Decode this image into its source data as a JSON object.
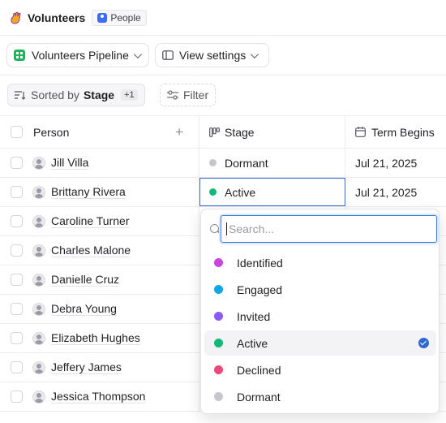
{
  "header": {
    "title": "Volunteers",
    "badge": "People"
  },
  "toolbar": {
    "pipeline_label": "Volunteers Pipeline",
    "view_settings_label": "View settings"
  },
  "sortbar": {
    "sorted_by": "Sorted by",
    "sort_field": "Stage",
    "sort_extra": "+1",
    "filter_label": "Filter"
  },
  "columns": {
    "person": "Person",
    "stage": "Stage",
    "term_begins": "Term Begins"
  },
  "rows": [
    {
      "name": "Jill Villa",
      "stage": "Dormant",
      "stage_color": "#c6c6cc",
      "term": "Jul 21, 2025"
    },
    {
      "name": "Brittany Rivera",
      "stage": "Active",
      "stage_color": "#14b878",
      "term": "Jul 21, 2025"
    },
    {
      "name": "Caroline Turner"
    },
    {
      "name": "Charles Malone"
    },
    {
      "name": "Danielle Cruz"
    },
    {
      "name": "Debra Young"
    },
    {
      "name": "Elizabeth Hughes"
    },
    {
      "name": "Jeffery James"
    },
    {
      "name": "Jessica Thompson"
    }
  ],
  "dropdown": {
    "search_placeholder": "Search...",
    "options": [
      {
        "label": "Identified",
        "color": "#c846e0"
      },
      {
        "label": "Engaged",
        "color": "#0ea7e8"
      },
      {
        "label": "Invited",
        "color": "#8b5cf6"
      },
      {
        "label": "Active",
        "color": "#14b878"
      },
      {
        "label": "Declined",
        "color": "#ec4879"
      },
      {
        "label": "Dormant",
        "color": "#c6c6cc"
      }
    ],
    "selected": "Active"
  }
}
